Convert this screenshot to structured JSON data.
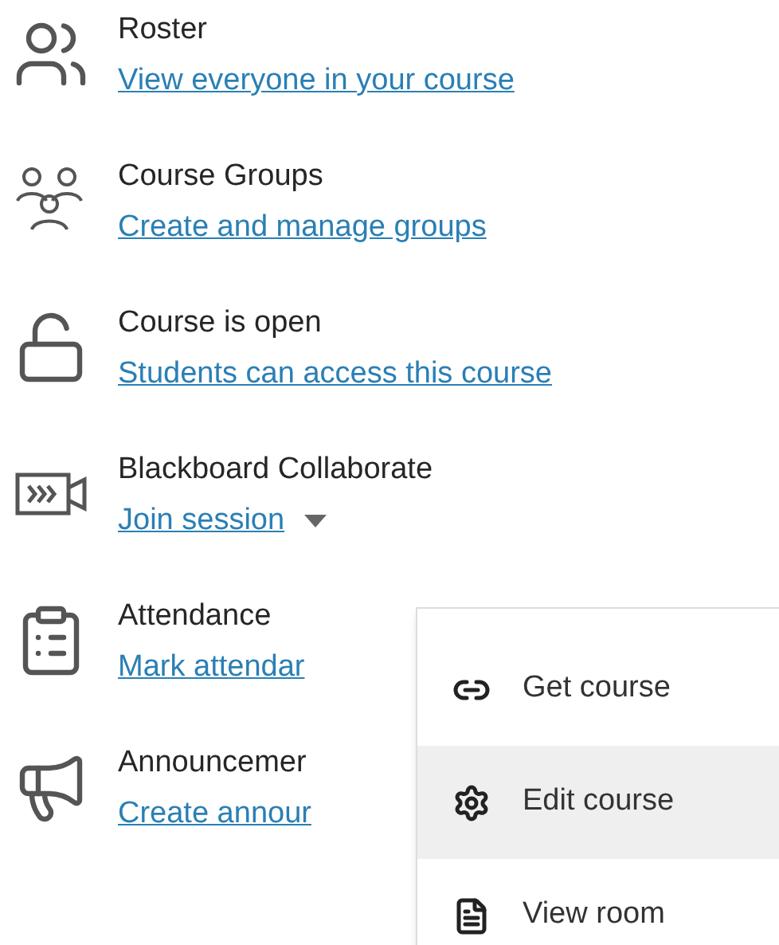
{
  "tools": [
    {
      "kind": "roster",
      "title": "Roster",
      "link": "View everyone in your course"
    },
    {
      "kind": "groups",
      "title": "Course Groups",
      "link": "Create and manage groups"
    },
    {
      "kind": "open",
      "title": "Course is open",
      "link": "Students can access this course"
    },
    {
      "kind": "collaborate",
      "title": "Blackboard Collaborate",
      "link": "Join session",
      "dropdown": {
        "expanded": true
      }
    },
    {
      "kind": "attendance",
      "title": "Attendance",
      "link": "Mark attendar"
    },
    {
      "kind": "announcements",
      "title": "Announcemer",
      "link": "Create annour"
    }
  ],
  "menu": {
    "items": [
      {
        "kind": "link",
        "label": "Get course",
        "selected": false
      },
      {
        "kind": "settings",
        "label": "Edit course",
        "selected": true
      },
      {
        "kind": "file",
        "label": "View room",
        "selected": false
      }
    ]
  }
}
